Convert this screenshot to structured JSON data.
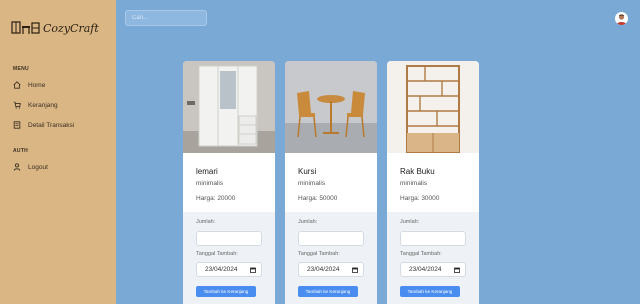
{
  "brand": {
    "name": "CozyCraft"
  },
  "sidebar": {
    "menu_title": "MENU",
    "menu_items": [
      {
        "label": "Home",
        "icon": "home-icon"
      },
      {
        "label": "Keranjang",
        "icon": "cart-icon"
      },
      {
        "label": "Detail Transaksi",
        "icon": "document-icon"
      }
    ],
    "auth_title": "AUTH",
    "auth_items": [
      {
        "label": "Logout",
        "icon": "user-icon"
      }
    ]
  },
  "topbar": {
    "search_placeholder": "Cari..."
  },
  "products": [
    {
      "name": "lemari",
      "desc": "minimalis",
      "price": "Harga: 20000",
      "qty_label": "Jumlah:",
      "date_label": "Tanggal Tambah:",
      "date_value": "23/04/2024",
      "button": "Tambah ke Keranjang"
    },
    {
      "name": "Kursi",
      "desc": "minimalis",
      "price": "Harga: 50000",
      "qty_label": "Jumlah:",
      "date_label": "Tanggal Tambah:",
      "date_value": "23/04/2024",
      "button": "Tambah ke Keranjang"
    },
    {
      "name": "Rak Buku",
      "desc": "minimalis",
      "price": "Harga: 30000",
      "qty_label": "Jumlah:",
      "date_label": "Tanggal Tambah:",
      "date_value": "23/04/2024",
      "button": "Tambah ke Keranjang"
    }
  ],
  "colors": {
    "sidebar": "#d9b684",
    "background": "#7ba9d6",
    "button": "#4a8df0"
  }
}
